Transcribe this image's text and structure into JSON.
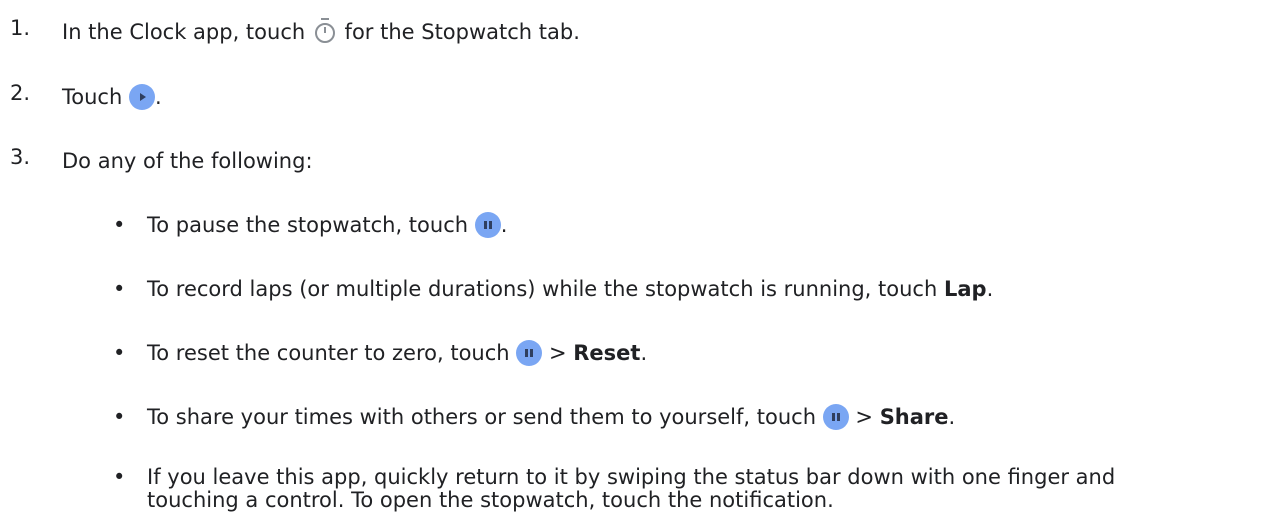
{
  "steps": [
    {
      "num": "1.",
      "a": "In the Clock app, touch",
      "b": "for the Stopwatch tab.",
      "icon": "stopwatch-icon"
    },
    {
      "num": "2.",
      "a": "Touch",
      "b": ".",
      "icon": "play-button-icon"
    },
    {
      "num": "3.",
      "a": "Do any of the following:"
    }
  ],
  "bullets": [
    {
      "a": "To pause the stopwatch, touch",
      "b": ".",
      "icon": "pause-button-icon"
    },
    {
      "a": "To record laps (or multiple durations) while the stopwatch is running, touch",
      "bold": "Lap",
      "b": "."
    },
    {
      "a": "To reset the counter to zero, touch",
      "sep": ">",
      "bold": "Reset",
      "b": ".",
      "icon": "pause-button-icon"
    },
    {
      "a": "To share your times with others or send them to yourself, touch",
      "sep": ">",
      "bold": "Share",
      "b": ".",
      "icon": "pause-button-icon"
    },
    {
      "line1": "If you leave this app, quickly return to it by swiping the status bar down with one finger and",
      "line2": "touching a control. To open the stopwatch, touch the notification."
    }
  ],
  "bullet_char": "•",
  "colors": {
    "button_fill": "#7aa6f3",
    "text": "#202124"
  }
}
